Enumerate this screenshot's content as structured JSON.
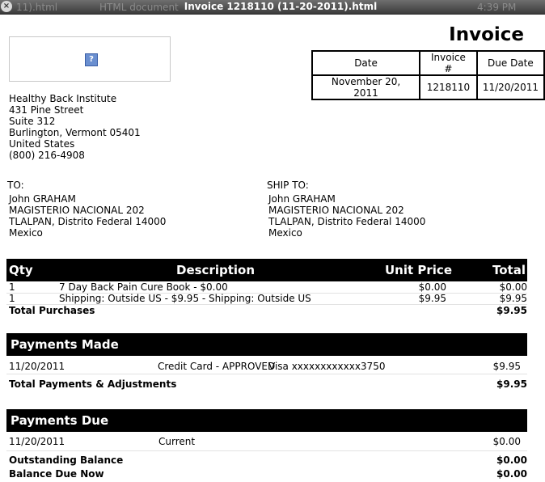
{
  "window": {
    "title": "Invoice 1218110 (11-20-2011).html",
    "ghost_left": "11).html",
    "ghost_mid": "HTML document",
    "ghost_time": "4:39 PM"
  },
  "invoice": {
    "heading": "Invoice",
    "meta_headers": [
      "Date",
      "Invoice #",
      "Due Date"
    ],
    "meta_values": [
      "November 20, 2011",
      "1218110",
      "11/20/2011"
    ]
  },
  "from": {
    "lines": [
      "Healthy Back Institute",
      "431 Pine Street",
      "Suite 312",
      "Burlington, Vermont 05401",
      "United States",
      "(800) 216-4908"
    ]
  },
  "to": {
    "label": "TO:",
    "lines": [
      "John GRAHAM",
      "MAGISTERIO NACIONAL 202",
      "TLALPAN, Distrito Federal 14000",
      "Mexico"
    ]
  },
  "ship_to": {
    "label": "SHIP TO:",
    "lines": [
      "John GRAHAM",
      "MAGISTERIO NACIONAL 202",
      "TLALPAN, Distrito Federal 14000",
      "Mexico"
    ]
  },
  "items": {
    "headers": {
      "qty": "Qty",
      "description": "Description",
      "unit_price": "Unit Price",
      "total": "Total"
    },
    "rows": [
      {
        "qty": "1",
        "description": "7 Day Back Pain Cure Book - $0.00",
        "unit_price": "$0.00",
        "total": "$0.00"
      },
      {
        "qty": "1",
        "description": "Shipping: Outside US - $9.95 - Shipping: Outside US",
        "unit_price": "$9.95",
        "total": "$9.95"
      }
    ],
    "total_label": "Total Purchases",
    "total_value": "$9.95"
  },
  "payments_made": {
    "heading": "Payments Made",
    "row": {
      "date": "11/20/2011",
      "method": "Credit Card - APPROVED",
      "card": "Visa xxxxxxxxxxxx3750",
      "amount": "$9.95"
    },
    "total_label": "Total Payments & Adjustments",
    "total_value": "$9.95"
  },
  "payments_due": {
    "heading": "Payments Due",
    "row": {
      "date": "11/20/2011",
      "status": "Current",
      "amount": "$0.00"
    },
    "outstanding_label": "Outstanding Balance",
    "outstanding_value": "$0.00",
    "balance_due_label": "Balance Due Now",
    "balance_due_value": "$0.00"
  }
}
